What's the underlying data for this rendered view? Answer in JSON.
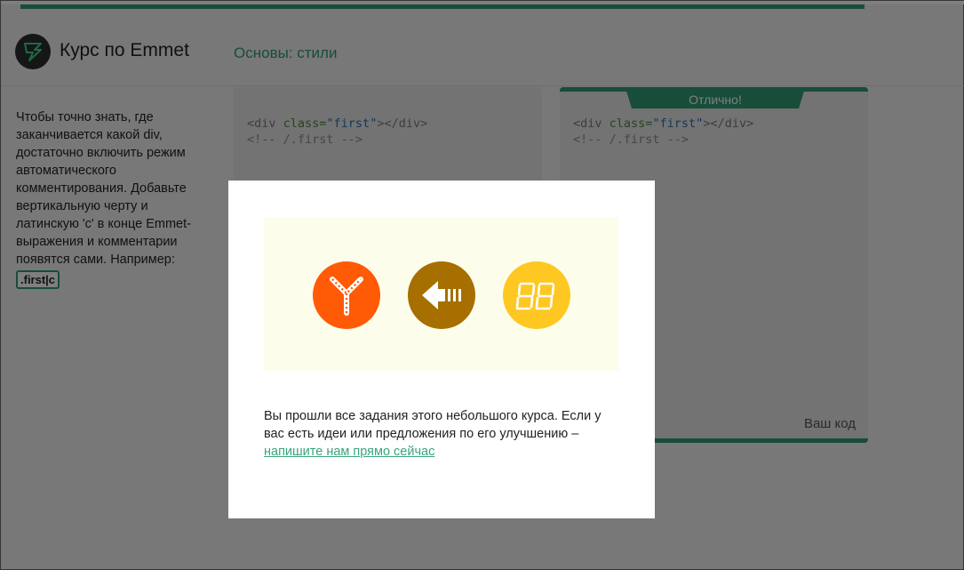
{
  "header": {
    "brand": "Курс по Emmet",
    "lesson_title": "Основы: стили"
  },
  "sidebar": {
    "description": "Чтобы точно знать, где заканчивается какой div, достаточно включить режим автоматического комментирования. Добавьте вертикальную черту и латинскую 'c' в конце Emmet-выражения и комментарии появятся сами. Например:",
    "example_code": ".first|c"
  },
  "editor_left": {
    "line1": {
      "open": "<div ",
      "attr": "class=",
      "str": "\"first\"",
      "close": "></div>"
    },
    "line2": "<!-- /.first -->"
  },
  "editor_right": {
    "status_label": "Отлично!",
    "line1": {
      "open": "<div ",
      "attr": "class=",
      "str": "\"first\"",
      "close": "></div>"
    },
    "line2": "<!-- /.first -->",
    "footer_label": "Ваш код"
  },
  "modal": {
    "badges": [
      "zipper-badge-icon",
      "arrow-badge-icon",
      "digital-display-badge-icon"
    ],
    "text_prefix": "Вы прошли все задания этого небольшого курса. Если у вас есть идеи или предложения по его улучшению – ",
    "link_text": "напишите нам прямо сейчас"
  },
  "colors": {
    "accent": "#2f9a72",
    "badge_orange": "#ff5a06",
    "badge_brown": "#a66f00",
    "badge_yellow": "#ffc721"
  }
}
